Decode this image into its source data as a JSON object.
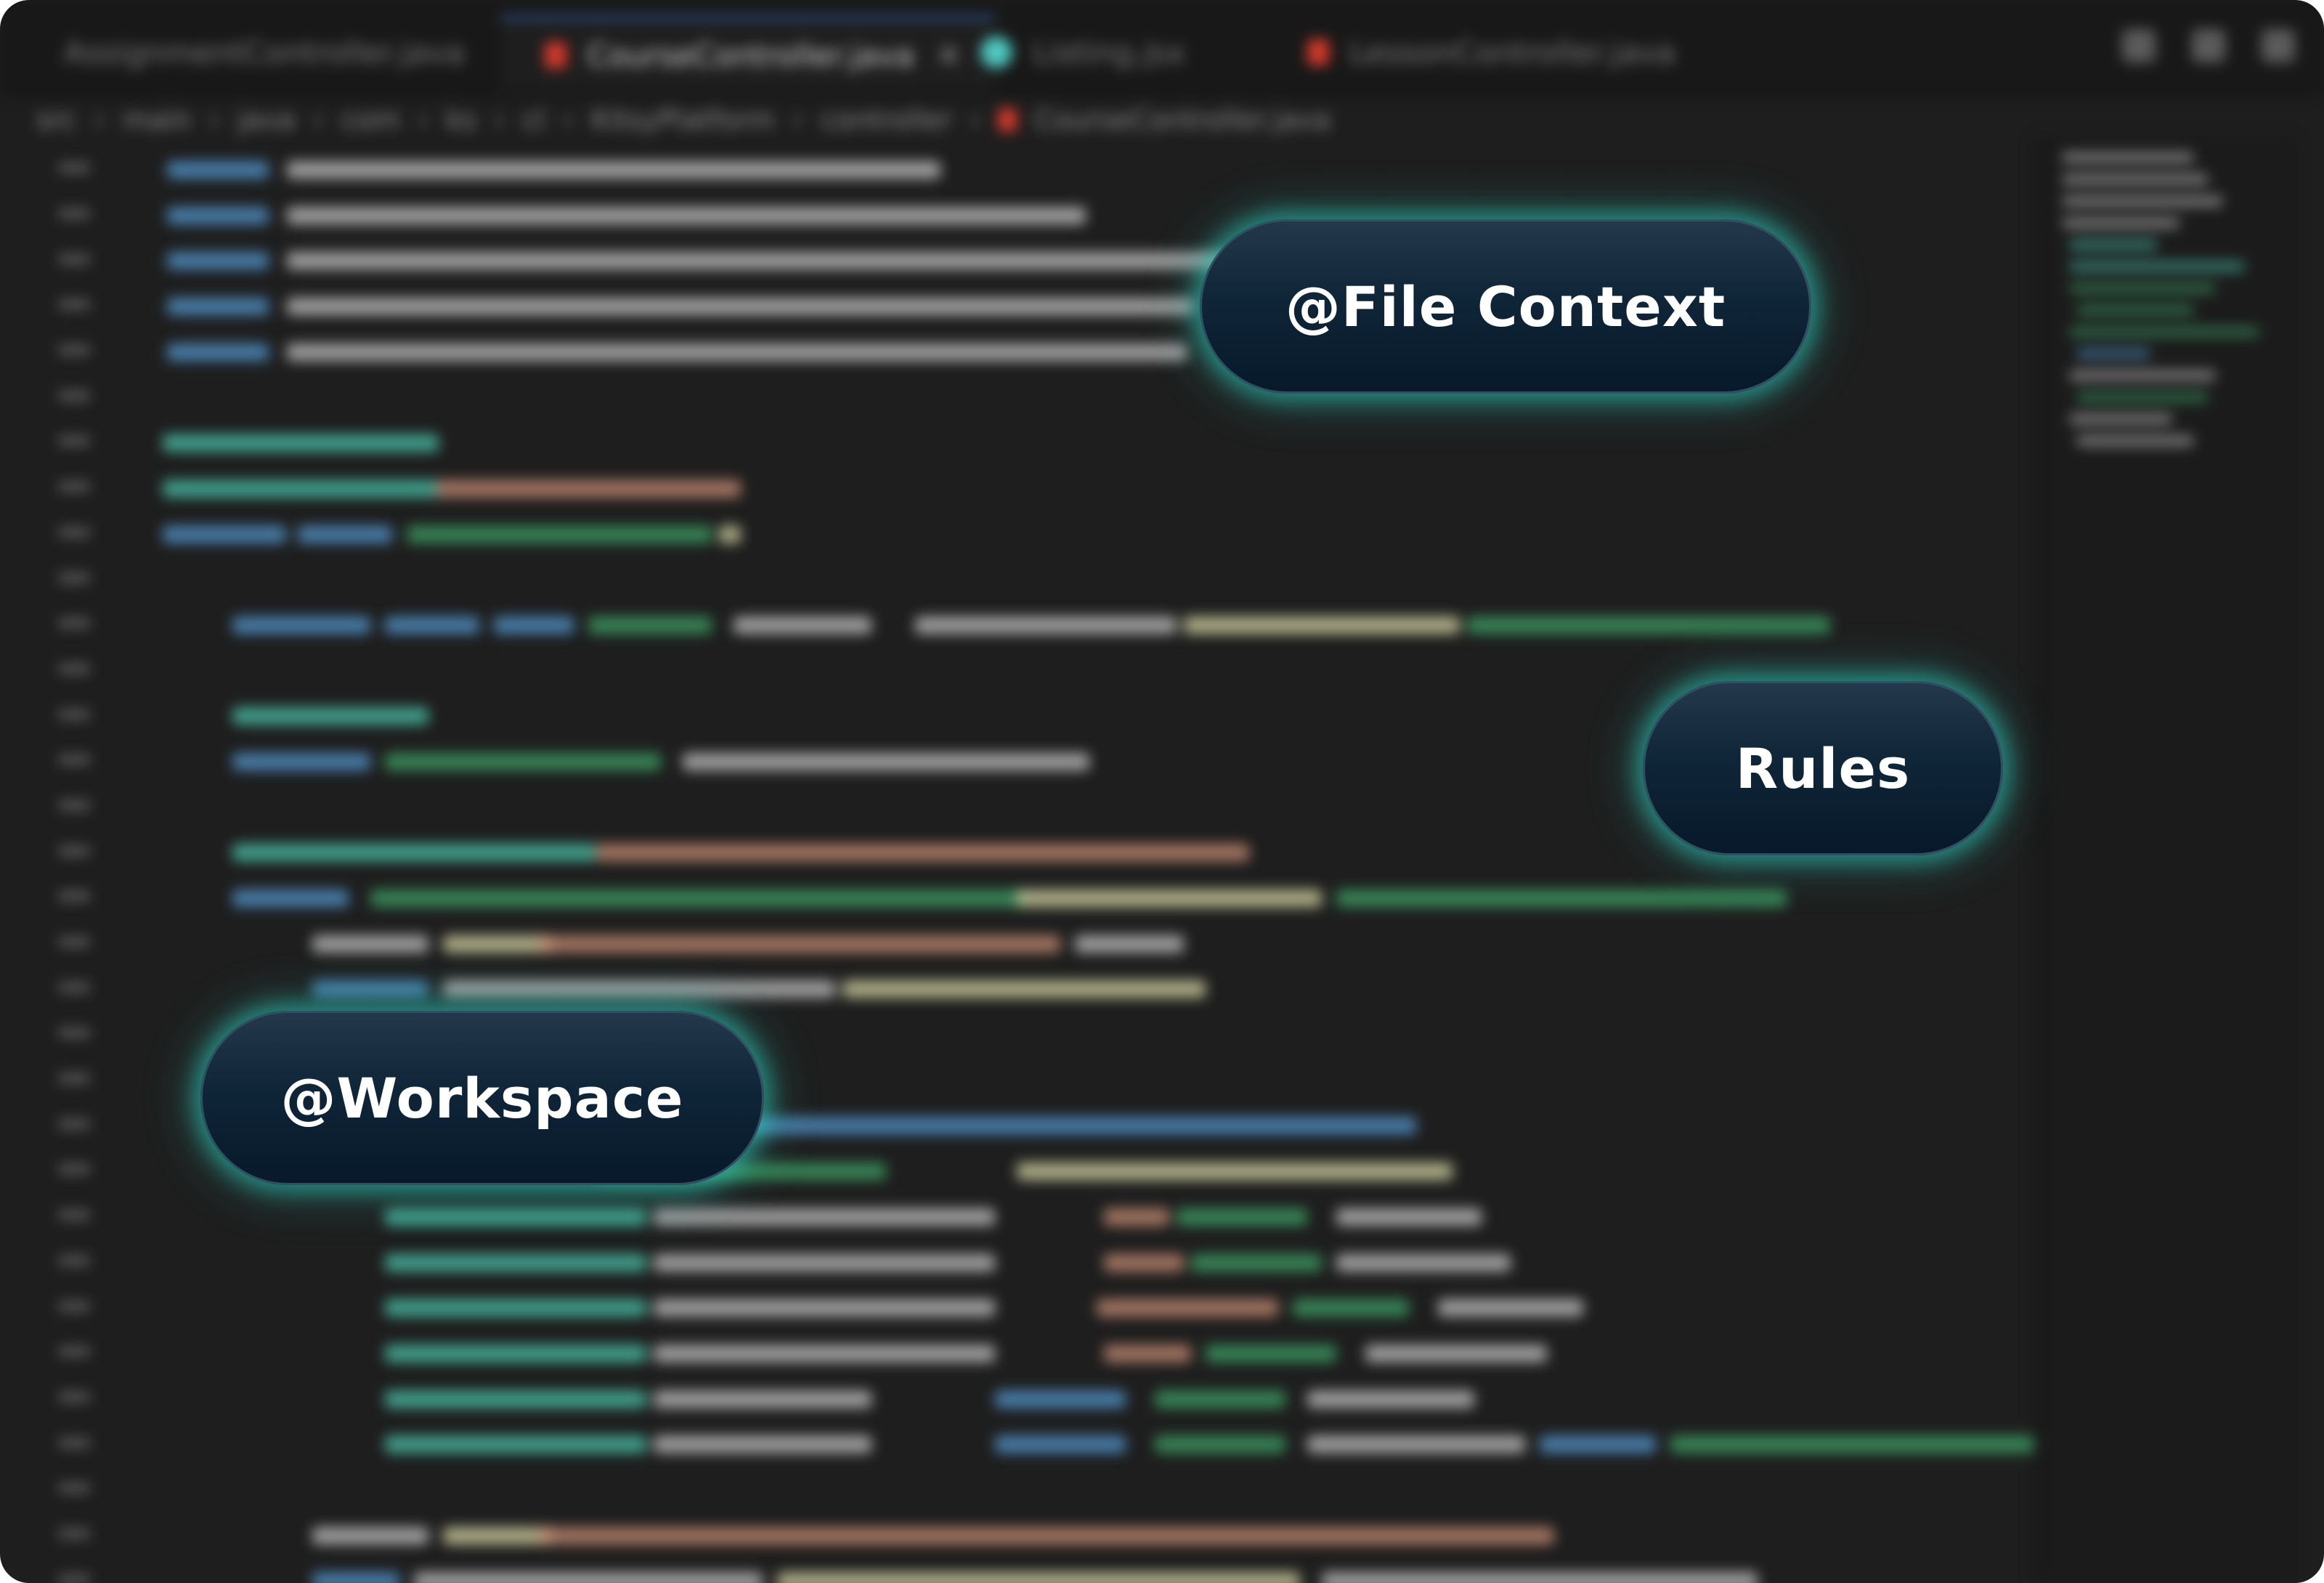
{
  "tabs": [
    {
      "label": "AssignmentController.java",
      "active": false,
      "icon": "java-file-icon"
    },
    {
      "label": "CourseController.java",
      "active": true,
      "icon": "java-file-icon"
    },
    {
      "label": "Listing.jsx",
      "active": false,
      "icon": "react-file-icon"
    },
    {
      "label": "LessonController.java",
      "active": false,
      "icon": "java-file-icon"
    }
  ],
  "breadcrumb": [
    "src",
    "main",
    "java",
    "com",
    "ks",
    "cl",
    "KitsyPlatform",
    "controller",
    "CourseController.java"
  ],
  "pills": {
    "file_context": "@File Context",
    "rules": "Rules",
    "workspace": "@Workspace"
  },
  "colors": {
    "editor_bg": "#1e1e1e",
    "keyword": "#569cd6",
    "annotation": "#4ec9b0",
    "type": "#3fa66a",
    "string": "#ce9178",
    "method": "#dcdcaa",
    "plain": "#c8c8c8",
    "glow": "#2ec4b6",
    "pill_bg": "#0f2538"
  }
}
